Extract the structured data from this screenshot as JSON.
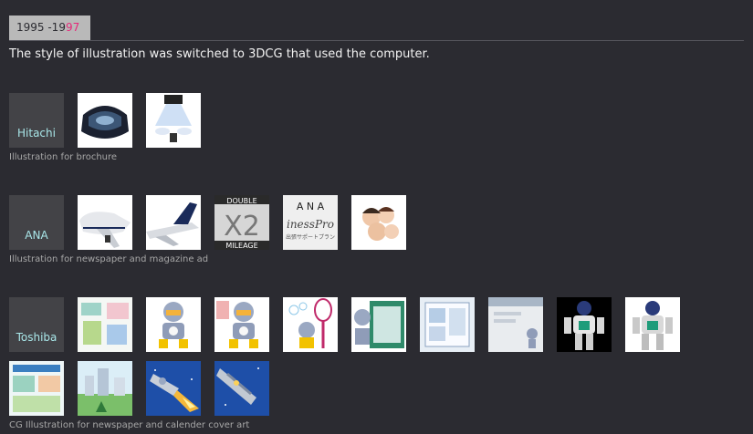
{
  "header": {
    "year_prefix": "1995 -19",
    "year_highlight": "97",
    "intro": "The style of illustration was switched to 3DCG that used the computer."
  },
  "colors": {
    "background": "#2b2b31",
    "badge": "#b9b9b9",
    "highlight": "#e5297a",
    "client_text": "#a9e7e9",
    "caption": "#a7a7a7"
  },
  "sections": [
    {
      "client": "Hitachi",
      "caption": "Illustration for brochure",
      "thumbs": [
        "hitachi-device-thumbnail",
        "hitachi-projector-thumbnail"
      ]
    },
    {
      "client": "ANA",
      "caption": "Illustration for newspaper and magazine ad",
      "thumbs": [
        "ana-jumbo-jet-thumbnail",
        "ana-plane-tail-thumbnail",
        "double-mileage-thumbnail",
        "ana-business-support-thumbnail",
        "ana-family-faces-thumbnail"
      ],
      "thumb_text": {
        "x2": "X2",
        "double": "DOUBLE",
        "mileage": "MILEAGE",
        "ana": "A N A",
        "business": "inessPro",
        "jp_line": "出張サポートプラン"
      }
    },
    {
      "client": "Toshiba",
      "caption": "CG Illustration for newspaper and calender cover art",
      "thumbs": [
        "toshiba-collage-thumbnail",
        "toshiba-robot-thumbnail-1",
        "toshiba-robot-thumbnail-2",
        "toshiba-robot-racket-thumbnail",
        "toshiba-robot-computer-thumbnail",
        "toshiba-screen-thumbnail",
        "toshiba-interface-thumbnail",
        "toshiba-robot-dark-thumbnail",
        "toshiba-robot-walking-thumbnail",
        "toshiba-newspaper-thumbnail",
        "toshiba-city-thumbnail",
        "toshiba-rocket-thumbnail-1",
        "toshiba-rocket-thumbnail-2"
      ]
    }
  ]
}
